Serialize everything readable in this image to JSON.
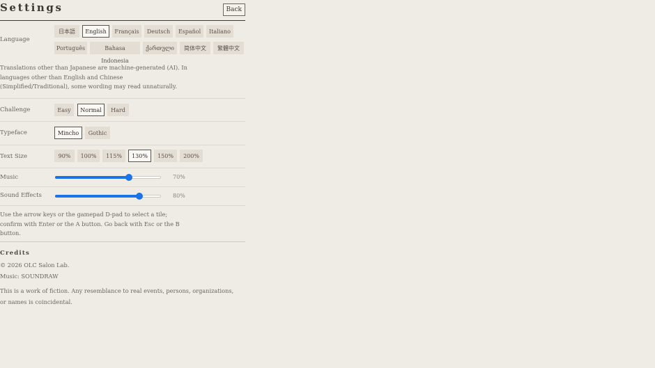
{
  "header": {
    "title": "Settings",
    "back_label": "Back"
  },
  "language": {
    "label": "Language",
    "options": [
      "日本語",
      "English",
      "Français",
      "Deutsch",
      "Español",
      "Italiano",
      "Português",
      "Bahasa Indonesia",
      "ქართული",
      "简体中文",
      "繁體中文"
    ],
    "selected": "English",
    "note": "Translations other than Japanese are machine-generated (AI). In languages other than English and Chinese (Simplified/Traditional), some wording may read unnaturally."
  },
  "challenge": {
    "label": "Challenge",
    "options": [
      "Easy",
      "Normal",
      "Hard"
    ],
    "selected": "Normal"
  },
  "typeface": {
    "label": "Typeface",
    "options": [
      "Mincho",
      "Gothic"
    ],
    "selected": "Mincho"
  },
  "text_size": {
    "label": "Text Size",
    "options": [
      "90%",
      "100%",
      "115%",
      "130%",
      "150%",
      "200%"
    ],
    "selected": "130%"
  },
  "music": {
    "label": "Music",
    "value_text": "70%",
    "level": 0.7
  },
  "sound_effects": {
    "label": "Sound Effects",
    "value_text": "80%",
    "level": 0.8
  },
  "controls_note": "Use the arrow keys or the gamepad D-pad to select a tile; confirm with Enter or the A button. Go back with Esc or the B button.",
  "credits": {
    "title": "Credits",
    "copyright": "© 2026 OLC Salon Lab.",
    "music": "Music: SOUNDRAW",
    "disclaimer": "This is a work of fiction. Any resemblance to real events, persons, organizations, or names is coincidental."
  },
  "colors": {
    "background": "#efebe5",
    "accent": "#1a73e8",
    "selected_option_border": "#5a544d",
    "option_background": "#e3ddd3"
  }
}
